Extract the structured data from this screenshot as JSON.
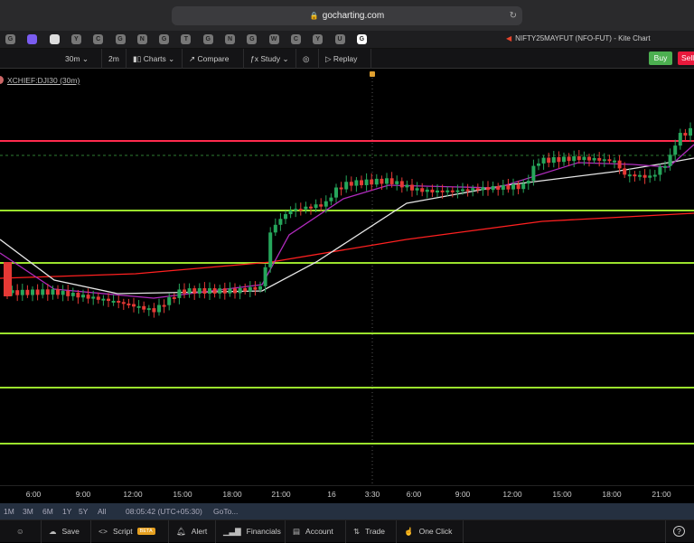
{
  "browser": {
    "url": "gocharting.com"
  },
  "favicons": [
    "G",
    "",
    "",
    "Y",
    "C",
    "G",
    "N",
    "G",
    "T",
    "G",
    "N",
    "G",
    "W",
    "C",
    "Y",
    "U",
    "G"
  ],
  "tab": {
    "title": "NIFTY25MAYFUT (NFO-FUT) - Kite Chart"
  },
  "toolbar": {
    "interval": "30m",
    "interval2": "2m",
    "charts": "Charts",
    "compare": "Compare",
    "study": "Study",
    "replay": "Replay",
    "buy": "Buy",
    "sell": "Sell"
  },
  "chart": {
    "symbol": "XCHIEF:DJI30 (30m)",
    "colors": {
      "up": "#26a65b",
      "down": "#e53935",
      "hline_red": "#ff2a4d",
      "hline_green": "#9be22d",
      "ma_white": "#e6e6e6",
      "ma_purple": "#b02bbd",
      "ma_red": "#ff2020"
    }
  },
  "time_axis": [
    "6:00",
    "9:00",
    "12:00",
    "15:00",
    "18:00",
    "21:00",
    "16",
    "3:30",
    "6:00",
    "9:00",
    "12:00",
    "15:00",
    "18:00",
    "21:00"
  ],
  "range_bar": {
    "ranges": [
      "1M",
      "3M",
      "6M",
      "1Y",
      "5Y",
      "All"
    ],
    "clock": "08:05:42 (UTC+05:30)",
    "goto": "GoTo..."
  },
  "bottom": {
    "save": "Save",
    "script": "Script",
    "beta": "BETA",
    "alert": "Alert",
    "financials": "Financials",
    "account": "Account",
    "trade": "Trade",
    "oneclick": "One Click",
    "help": "?"
  }
}
